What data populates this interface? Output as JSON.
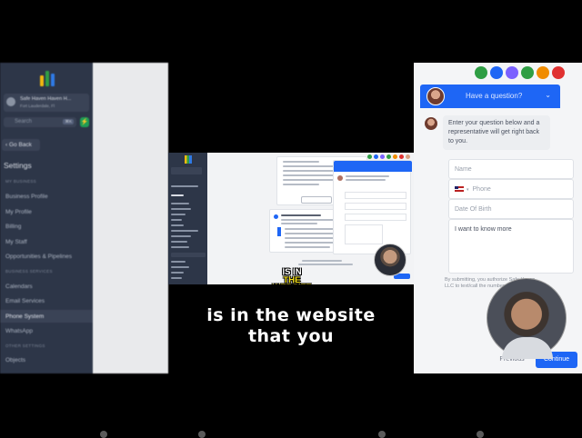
{
  "left_sidebar": {
    "location_name": "Safe Haven Haven H...",
    "location_sub": "Fort Lauderdale, Fl",
    "search_placeholder": "Search",
    "search_shortcut": "⌘K",
    "go_back": "Go Back",
    "settings_heading": "Settings",
    "sections": [
      {
        "label": "MY BUSINESS"
      },
      {
        "label": "BUSINESS SERVICES"
      },
      {
        "label": "OTHER SETTINGS"
      }
    ],
    "items": [
      {
        "label": "Business Profile"
      },
      {
        "label": "My Profile"
      },
      {
        "label": "Billing"
      },
      {
        "label": "My Staff"
      },
      {
        "label": "Opportunities & Pipelines"
      },
      {
        "label": "Calendars"
      },
      {
        "label": "Email Services"
      },
      {
        "label": "Phone System"
      },
      {
        "label": "WhatsApp"
      },
      {
        "label": "Objects"
      }
    ],
    "active_item": "Phone System"
  },
  "video_caption_small": {
    "line1": "IS IN",
    "line2": "THE WEBSITE"
  },
  "chat_widget": {
    "header_title": "Have a question?",
    "intro_message": "Enter your question below and a representative will get right back to you.",
    "name_placeholder": "Name",
    "phone_placeholder": "Phone",
    "dob_placeholder": "Date Of Birth",
    "message_value": "I want to know more",
    "disclaimer": "By submitting, you authorize Safe Haven LLC to text/call the number above",
    "previous_label": "Previous",
    "continue_label": "Continue"
  },
  "caption": {
    "line1": "is in the website",
    "line2": "that you"
  },
  "colors": {
    "accent": "#1e66f5",
    "sidebar_bg": "#2d3648",
    "caption_highlight": "#f7e21b"
  }
}
